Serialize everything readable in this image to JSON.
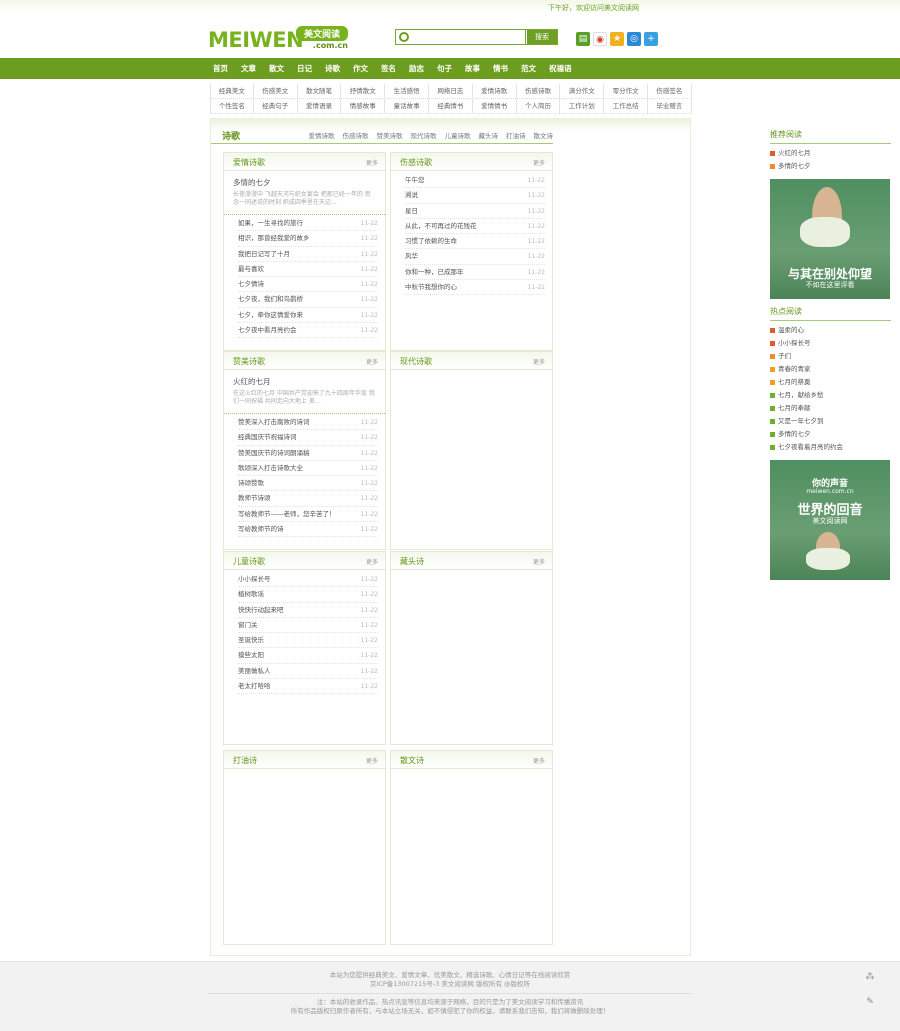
{
  "topbar": {
    "greeting": "下午好，欢迎访问美文阅读网"
  },
  "logo": {
    "en": "MEIWEN",
    "cn": "美文阅读",
    "domain": ".com.cn"
  },
  "search": {
    "placeholder": "",
    "button": "搜索"
  },
  "share_icons": [
    "book-icon",
    "weibo-icon",
    "star-icon",
    "qq-icon",
    "plus-icon"
  ],
  "nav": [
    "首页",
    "文章",
    "散文",
    "日记",
    "诗歌",
    "作文",
    "签名",
    "励志",
    "句子",
    "故事",
    "情书",
    "范文",
    "祝福语"
  ],
  "subnav": [
    [
      "经典美文",
      "伤感美文",
      "散文随笔",
      "抒情散文",
      "生活感悟",
      "网络日志",
      "爱情诗歌",
      "伤感诗歌",
      "满分作文",
      "零分作文",
      "伤感签名"
    ],
    [
      "个性签名",
      "经典句子",
      "爱情语录",
      "情感故事",
      "童话故事",
      "经典情书",
      "爱情情书",
      "个人简历",
      "工作计划",
      "工作总结",
      "毕业赠言"
    ]
  ],
  "poem_section": {
    "title": "诗歌",
    "links": [
      "爱情诗歌",
      "伤感诗歌",
      "赞美诗歌",
      "现代诗歌",
      "儿童诗歌",
      "藏头诗",
      "打油诗",
      "散文诗"
    ]
  },
  "boxes": [
    {
      "title": "爱情诗歌",
      "more": "更多",
      "feature": {
        "title": "多情的七夕",
        "desc": "长夜漫漫中 飞越天河与织女宴会 把那已经一年的 思念一同述说的时刻 织成四季里在天边…"
      },
      "items": [
        {
          "t": "如果，一生寻找的旅行",
          "d": "11-22"
        },
        {
          "t": "相识，那曾经我爱的故乡",
          "d": "11-22"
        },
        {
          "t": "我把日记写了十月",
          "d": "11-22"
        },
        {
          "t": "最与喜欢",
          "d": "11-22"
        },
        {
          "t": "七夕情诗",
          "d": "11-22"
        },
        {
          "t": "七夕夜，我们和鸟鹊桥",
          "d": "11-22"
        },
        {
          "t": "七夕，牵你这情爱你来",
          "d": "11-22"
        },
        {
          "t": "七夕夜中看月亮约会",
          "d": "11-22"
        }
      ]
    },
    {
      "title": "伤感诗歌",
      "more": "更多",
      "items": [
        {
          "t": "午午您",
          "d": "11-22"
        },
        {
          "t": "溯说",
          "d": "11-22"
        },
        {
          "t": "星日",
          "d": "11-22"
        },
        {
          "t": "从此，不可再过的花残花",
          "d": "11-22"
        },
        {
          "t": "习惯了依赖的生命",
          "d": "11-22"
        },
        {
          "t": "风华",
          "d": "11-22"
        },
        {
          "t": "你和一种，已成那年",
          "d": "11-22"
        },
        {
          "t": "中秋节我想你的心",
          "d": "11-22"
        }
      ]
    },
    {
      "title": "赞美诗歌",
      "more": "更多",
      "feature": {
        "title": "火红的七月",
        "desc": "在这火红的七月 中国共产党迎来了九十四周年华诞 我们一同祝福 共同走向大地上 美…"
      },
      "items": [
        {
          "t": "赞美深入打击腐败的诗词",
          "d": "11-22"
        },
        {
          "t": "经典国庆节祝福诗词",
          "d": "11-22"
        },
        {
          "t": "赞美国庆节的诗词朗诵稿",
          "d": "11-22"
        },
        {
          "t": "歌颂深入打击诗歌大全",
          "d": "11-22"
        },
        {
          "t": "诗颂赞歌",
          "d": "11-22"
        },
        {
          "t": "教师节诗颂",
          "d": "11-22"
        },
        {
          "t": "写给教师节——老师，您辛苦了！",
          "d": "11-22"
        },
        {
          "t": "写给教师节的诗",
          "d": "11-22"
        }
      ]
    },
    {
      "title": "现代诗歌",
      "more": "更多",
      "items": []
    },
    {
      "title": "儿童诗歌",
      "more": "更多",
      "items": [
        {
          "t": "小小探长号",
          "d": "11-22"
        },
        {
          "t": "植树歌谣",
          "d": "11-22"
        },
        {
          "t": "快快行动起来吧",
          "d": "11-22"
        },
        {
          "t": "窗门关",
          "d": "11-22"
        },
        {
          "t": "圣诞快乐",
          "d": "11-22"
        },
        {
          "t": "摸些太阳",
          "d": "11-22"
        },
        {
          "t": "美丽做私人",
          "d": "11-22"
        },
        {
          "t": "老太打哈哈",
          "d": "11-22"
        }
      ]
    },
    {
      "title": "藏头诗",
      "more": "更多",
      "items": []
    },
    {
      "title": "打油诗",
      "more": "更多",
      "items": []
    },
    {
      "title": "散文诗",
      "more": "更多",
      "items": []
    }
  ],
  "sidebar": {
    "recommend_title": "推荐阅读",
    "recommend": [
      "火红的七月",
      "多情的七夕"
    ],
    "ad1": {
      "big": "与其在别处仰望",
      "small": "不如在这里评看"
    },
    "hot_title": "热点阅读",
    "hot": [
      "温柔的心",
      "小小探长号",
      "子们",
      "青春的青家",
      "七月的祭奠",
      "七月，献给乡愁",
      "七月的奉献",
      "又是一年七夕到",
      "多情的七夕",
      "七夕夜看着月亮的约会"
    ],
    "hot_colors": [
      "#e05a2a",
      "#e05a2a",
      "#f08a2a",
      "#f0a020",
      "#f0a020",
      "#6cb030",
      "#6cb030",
      "#6cb030",
      "#6cb030",
      "#6cb030"
    ],
    "ad2": {
      "title": "你的声音",
      "domain": "meiwen.com.cn",
      "big": "世界的回音",
      "small": "美文阅读网"
    }
  },
  "footer": {
    "line1": "本站为您提供经典美文、爱情文章、优美散文、精选诗歌、心情日记等在线阅读欣赏",
    "line2": "京ICP备13007215号-3 美文阅读网 版权所有 @版权所",
    "line3": "注：本站的收录作品、热点讯息等信息均来源于网络，目的只是为了美文阅读学习和传播资讯",
    "line4": "所有作品版权归原作者所有，与本站立场无关，如不慎侵犯了你的权益，请联系我们告知，我们将做删除处理！"
  },
  "float_icons": [
    "share-icon",
    "edit-icon"
  ]
}
